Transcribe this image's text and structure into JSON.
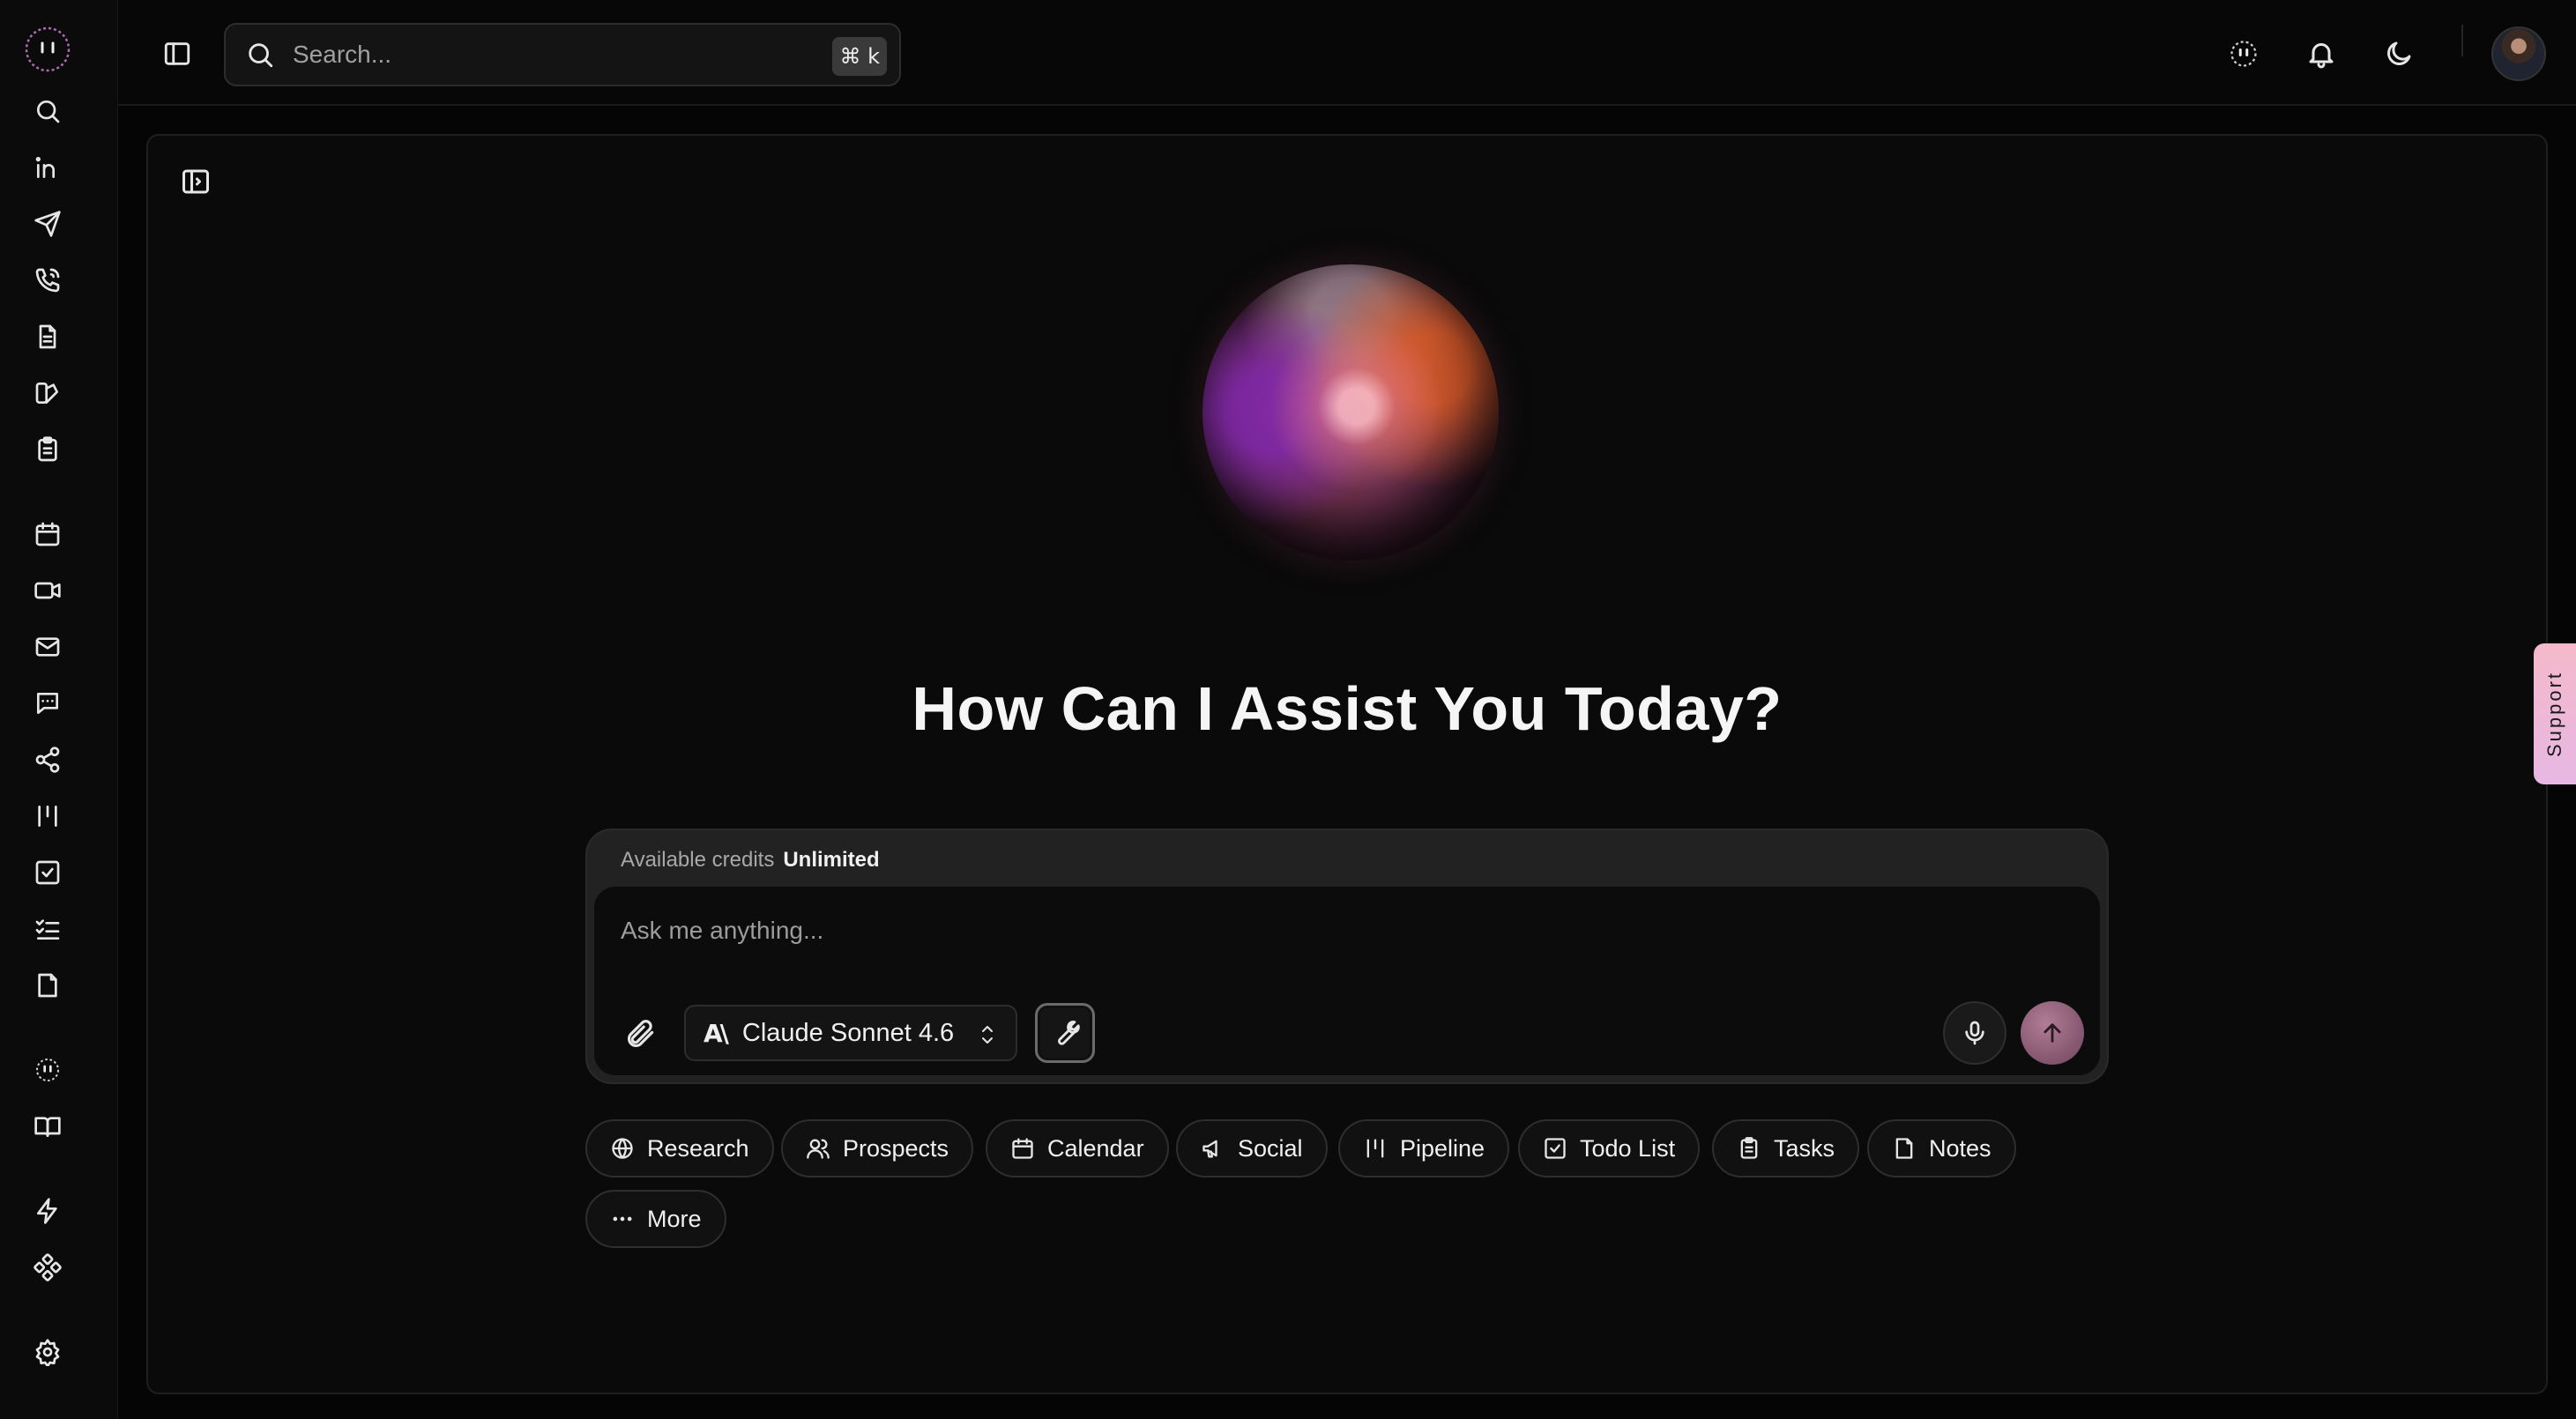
{
  "search": {
    "placeholder": "Search...",
    "shortcut": "⌘ k"
  },
  "sidebar": {
    "items": [
      {
        "icon": "search-icon"
      },
      {
        "icon": "linkedin-icon"
      },
      {
        "icon": "send-icon"
      },
      {
        "icon": "phone-icon"
      },
      {
        "icon": "document-icon"
      },
      {
        "icon": "brand-icon"
      },
      {
        "icon": "clipboard-icon"
      },
      {
        "icon": "calendar-icon"
      },
      {
        "icon": "video-icon"
      },
      {
        "icon": "mail-icon"
      },
      {
        "icon": "chat-icon"
      },
      {
        "icon": "share-icon"
      },
      {
        "icon": "pipeline-icon"
      },
      {
        "icon": "todo-icon"
      },
      {
        "icon": "list-check-icon"
      },
      {
        "icon": "note-icon"
      },
      {
        "icon": "assistant-icon"
      },
      {
        "icon": "book-icon"
      },
      {
        "icon": "lightning-icon"
      },
      {
        "icon": "integrations-icon"
      },
      {
        "icon": "settings-icon"
      }
    ]
  },
  "main": {
    "headline": "How Can I Assist You Today?"
  },
  "composer": {
    "credits_label": "Available credits",
    "credits_value": "Unlimited",
    "placeholder": "Ask me anything...",
    "model_name": "Claude Sonnet 4.6"
  },
  "chips": [
    {
      "label": "Research",
      "icon": "globe-icon"
    },
    {
      "label": "Prospects",
      "icon": "users-icon"
    },
    {
      "label": "Calendar",
      "icon": "calendar-icon"
    },
    {
      "label": "Social",
      "icon": "megaphone-icon"
    },
    {
      "label": "Pipeline",
      "icon": "pipeline-icon"
    },
    {
      "label": "Todo List",
      "icon": "todo-icon"
    },
    {
      "label": "Tasks",
      "icon": "clipboard-icon"
    },
    {
      "label": "Notes",
      "icon": "note-icon"
    },
    {
      "label": "More",
      "icon": "more-icon"
    }
  ],
  "support": {
    "label": "Support"
  },
  "colors": {
    "background": "#050505",
    "panel": "#0a0a0a",
    "accent_send": "#8a5a74",
    "support_tab": "#f4b9c9"
  }
}
